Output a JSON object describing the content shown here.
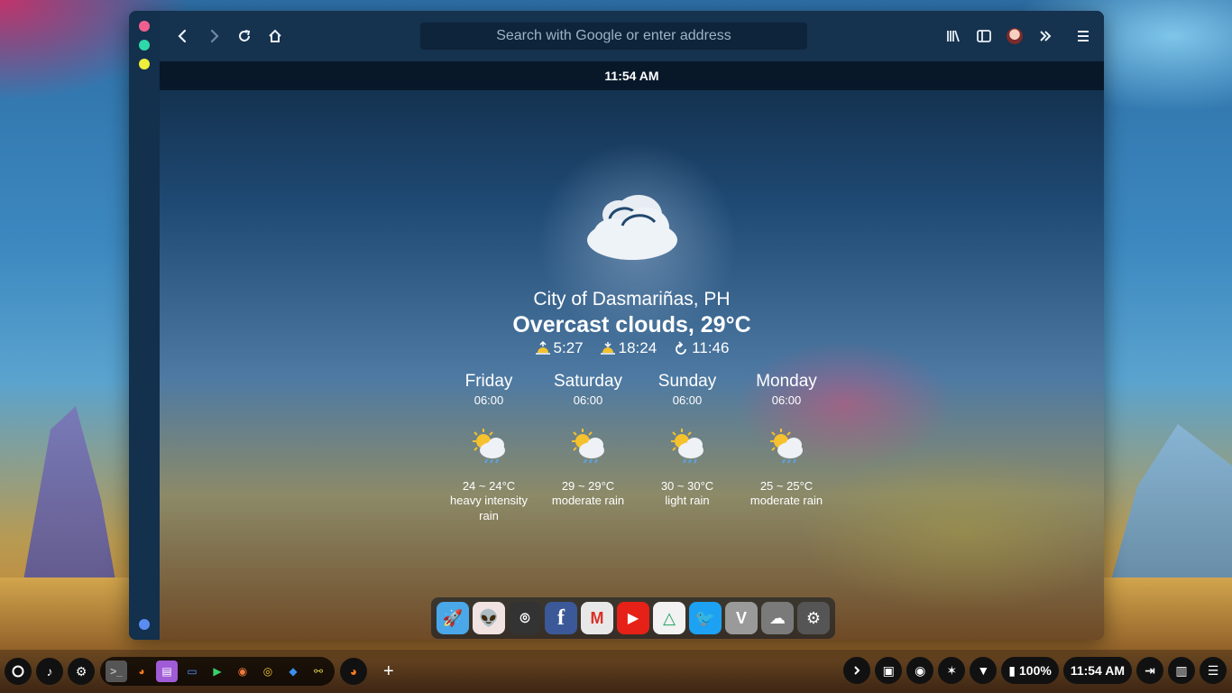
{
  "browser": {
    "url_placeholder": "Search with Google or enter address",
    "toolbar": {
      "back_icon": "back-arrow-icon",
      "forward_icon": "forward-arrow-icon",
      "reload_icon": "reload-icon",
      "home_icon": "home-icon",
      "library_icon": "library-icon",
      "sidebar_icon": "sidebar-icon",
      "account_icon": "avatar-icon",
      "overflow_icon": "chevrons-right-icon",
      "menu_icon": "hamburger-menu-icon"
    },
    "window_controls": {
      "close_color": "#f0608e",
      "maximize_color": "#2fd8a8",
      "minimize_color": "#eef03c"
    }
  },
  "clock": "11:54 AM",
  "weather": {
    "icon": "overcast-cloud-icon",
    "city": "City of Dasmariñas, PH",
    "condition": "Overcast clouds, 29°C",
    "sunrise": "5:27",
    "sunset": "18:24",
    "day_length": "11:46",
    "forecast": [
      {
        "day": "Friday",
        "time": "06:00",
        "icon": "sun-cloud-rain-icon",
        "temp": "24 ~ 24°C",
        "desc": "heavy intensity rain"
      },
      {
        "day": "Saturday",
        "time": "06:00",
        "icon": "sun-cloud-rain-icon",
        "temp": "29 ~ 29°C",
        "desc": "moderate rain"
      },
      {
        "day": "Sunday",
        "time": "06:00",
        "icon": "sun-cloud-rain-icon",
        "temp": "30 ~ 30°C",
        "desc": "light rain"
      },
      {
        "day": "Monday",
        "time": "06:00",
        "icon": "sun-cloud-rain-icon",
        "temp": "25 ~ 25°C",
        "desc": "moderate rain"
      }
    ]
  },
  "dock": [
    {
      "name": "rocket-app-icon",
      "glyph": "🚀",
      "bg": "#4aa7e8"
    },
    {
      "name": "reddit-icon",
      "glyph": "👽",
      "bg": "#f2e3e3"
    },
    {
      "name": "github-icon",
      "glyph": "⌾",
      "bg": "#333333"
    },
    {
      "name": "facebook-icon",
      "glyph": "f",
      "bg": "#3b5998"
    },
    {
      "name": "gmail-icon",
      "glyph": "M",
      "bg": "#e8e8e8"
    },
    {
      "name": "youtube-icon",
      "glyph": "▶",
      "bg": "#e62117"
    },
    {
      "name": "google-drive-icon",
      "glyph": "△",
      "bg": "#f2f2f2"
    },
    {
      "name": "twitter-icon",
      "glyph": "🐦",
      "bg": "#1da1f2"
    },
    {
      "name": "vivaldi-icon",
      "glyph": "V",
      "bg": "#9a9a9a"
    },
    {
      "name": "weather-app-icon",
      "glyph": "☁",
      "bg": "#7a7a7a"
    },
    {
      "name": "settings-icon",
      "glyph": "⚙",
      "bg": "#555555"
    }
  ],
  "taskbar": {
    "launcher_icon": "circle-launcher-icon",
    "music_icon": "music-note-icon",
    "settings_icon": "gear-icon",
    "apps": [
      {
        "name": "terminal-icon",
        "glyph": ">_",
        "color": "#bbbbbb"
      },
      {
        "name": "firefox-icon",
        "glyph": "🦊",
        "color": "#ff7a1a"
      },
      {
        "name": "text-editor-icon",
        "glyph": "▤",
        "color": "#a05bd6"
      },
      {
        "name": "file-manager-icon",
        "glyph": "▭",
        "color": "#5a8cff"
      },
      {
        "name": "media-player-icon",
        "glyph": "▶",
        "color": "#3ccf6a"
      },
      {
        "name": "games-icon",
        "glyph": "◉",
        "color": "#f07a3a"
      },
      {
        "name": "chrome-icon",
        "glyph": "◎",
        "color": "#f2c230"
      },
      {
        "name": "3d-box-icon",
        "glyph": "◆",
        "color": "#3a8ef0"
      },
      {
        "name": "network-tool-icon",
        "glyph": "⚯",
        "color": "#d8c84a"
      }
    ],
    "pinned_firefox": "firefox-icon",
    "add_label": "+",
    "status": {
      "expand_icon": "chevron-right-icon",
      "store_icon": "store-icon",
      "record_icon": "record-icon",
      "bluetooth_icon": "bluetooth-off-icon",
      "wifi_icon": "wifi-icon",
      "battery_icon": "battery-icon",
      "battery": "100%",
      "time": "11:54 AM",
      "logout_icon": "logout-icon",
      "layout_icon": "layout-icon",
      "list_icon": "list-icon"
    }
  }
}
